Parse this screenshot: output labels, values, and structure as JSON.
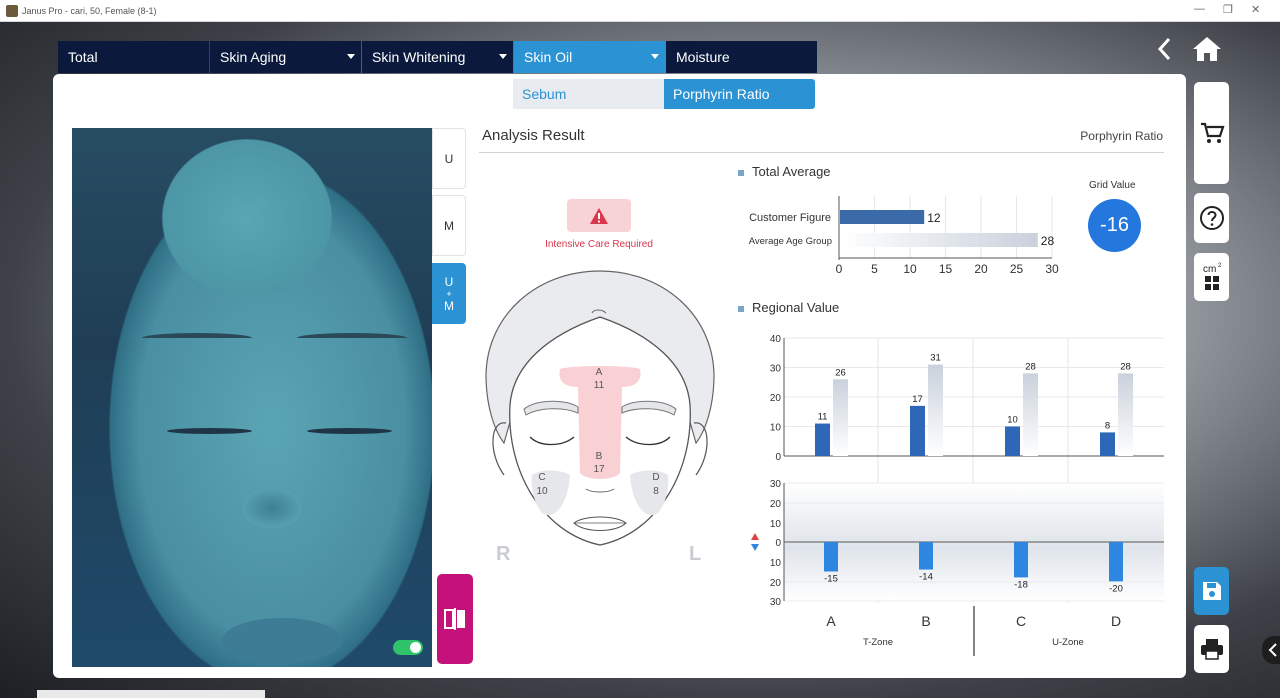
{
  "window": {
    "title": "Janus Pro - cari, 50, Female (8-1)"
  },
  "tabs": [
    {
      "label": "Total",
      "dropdown": false,
      "active": false
    },
    {
      "label": "Skin Aging",
      "dropdown": true,
      "active": false
    },
    {
      "label": "Skin Whitening",
      "dropdown": true,
      "active": false
    },
    {
      "label": "Skin Oil",
      "dropdown": true,
      "active": true
    },
    {
      "label": "Moisture",
      "dropdown": false,
      "active": false
    }
  ],
  "subtabs": [
    {
      "label": "Sebum",
      "active": false
    },
    {
      "label": "Porphyrin Ratio",
      "active": true
    }
  ],
  "view_buttons": {
    "u": "U",
    "m": "M",
    "um_u": "U",
    "um_plus": "+",
    "um_m": "M"
  },
  "analysis": {
    "title": "Analysis Result",
    "metric": "Porphyrin Ratio",
    "warning": "Intensive Care Required",
    "side_right": "R",
    "side_left": "L",
    "regions": [
      {
        "id": "A",
        "value": "11"
      },
      {
        "id": "B",
        "value": "17"
      },
      {
        "id": "C",
        "value": "10"
      },
      {
        "id": "D",
        "value": "8"
      }
    ]
  },
  "total_average": {
    "label": "Total Average",
    "grid_value_label": "Grid Value",
    "grid_value": "-16"
  },
  "regional_value": {
    "label": "Regional Value"
  },
  "colors": {
    "navy_tab": "#0b1a3c",
    "accent_blue": "#2b92d4",
    "customer_bar": "#3a6aa8",
    "regional_bar": "#2f67b8",
    "lower_bar": "#2f86e0",
    "warn_red": "#d9374e",
    "grid_circle": "#2477dc",
    "compare_magenta": "#c5127a"
  },
  "chart_data": [
    {
      "type": "bar",
      "orientation": "horizontal",
      "categories": [
        "Customer Figure",
        "Average Age Group"
      ],
      "values": [
        12,
        28
      ],
      "xlim": [
        0,
        30
      ],
      "xticks": [
        0,
        5,
        10,
        15,
        20,
        25,
        30
      ]
    },
    {
      "type": "bar",
      "categories": [
        "A",
        "B",
        "C",
        "D"
      ],
      "series": [
        {
          "values": [
            11,
            17,
            10,
            8
          ]
        },
        {
          "values": [
            26,
            31,
            28,
            28
          ]
        }
      ],
      "ylim": [
        0,
        40
      ],
      "yticks": [
        0,
        10,
        20,
        30,
        40
      ],
      "groups": [
        {
          "name": "T-Zone",
          "categories": [
            "A",
            "B"
          ]
        },
        {
          "name": "U-Zone",
          "categories": [
            "C",
            "D"
          ]
        }
      ]
    },
    {
      "type": "bar",
      "categories": [
        "A",
        "B",
        "C",
        "D"
      ],
      "values": [
        -15,
        -14,
        -18,
        -20
      ],
      "ylim": [
        -30,
        30
      ],
      "yticks": [
        30,
        20,
        10,
        0,
        10,
        20,
        30
      ]
    }
  ]
}
